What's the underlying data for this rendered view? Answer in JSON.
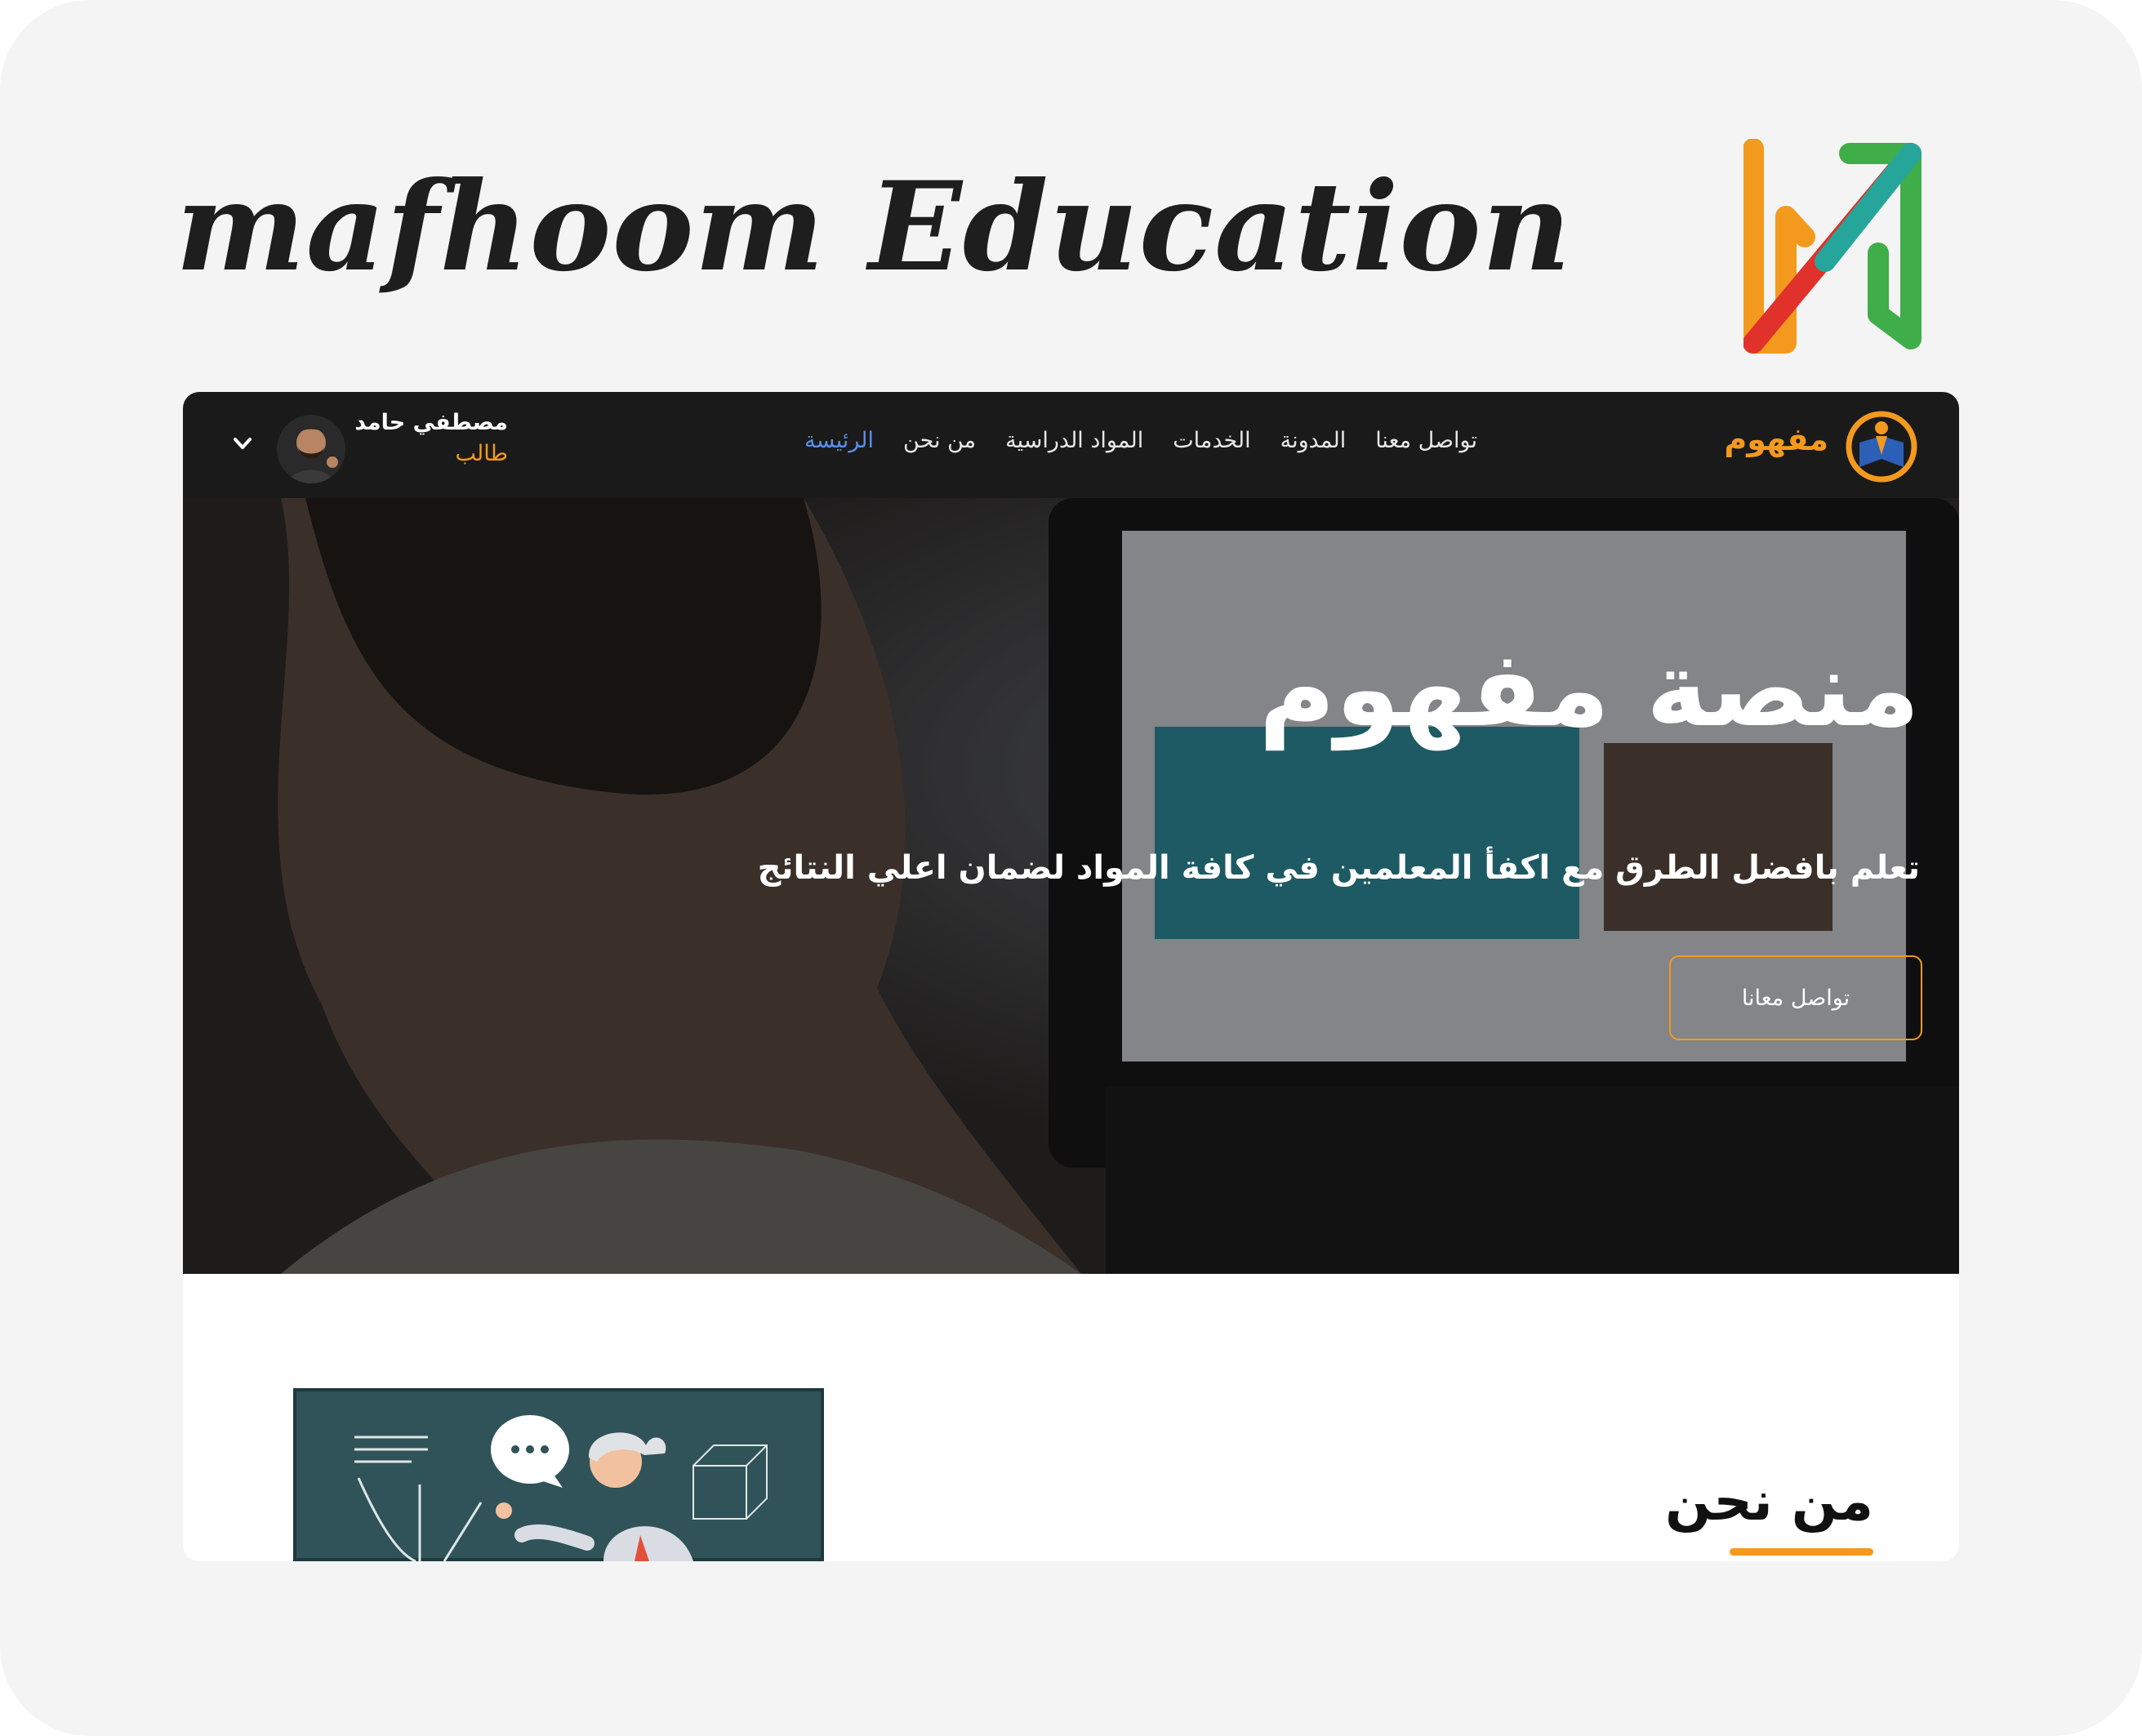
{
  "brand": {
    "title": "mafhoom  Education"
  },
  "navbar": {
    "logo_text": "مفهوم",
    "links": [
      {
        "label": "الرئيسة",
        "active": true
      },
      {
        "label": "من نحن",
        "active": false
      },
      {
        "label": "المواد الدراسية",
        "active": false
      },
      {
        "label": "الخدمات",
        "active": false
      },
      {
        "label": "المدونة",
        "active": false
      },
      {
        "label": "تواصل معنا",
        "active": false
      }
    ],
    "user": {
      "name": "مصطفي حامد",
      "role": "طالب"
    },
    "dropdown_icon": "chevron-down-icon"
  },
  "hero": {
    "title": "منصة مفهوم",
    "subtitle": "تعلم بافضل الطرق مع اكفأ المعلمين في كافة المواد لضمان اعلي النتائج",
    "cta_label": "تواصل معانا"
  },
  "about": {
    "title": "من نحن"
  },
  "colors": {
    "accent_orange": "#f39a1e",
    "active_link": "#5b8fe8",
    "navbar_bg": "#1a1a1a",
    "card_bg": "#f4f4f4"
  }
}
